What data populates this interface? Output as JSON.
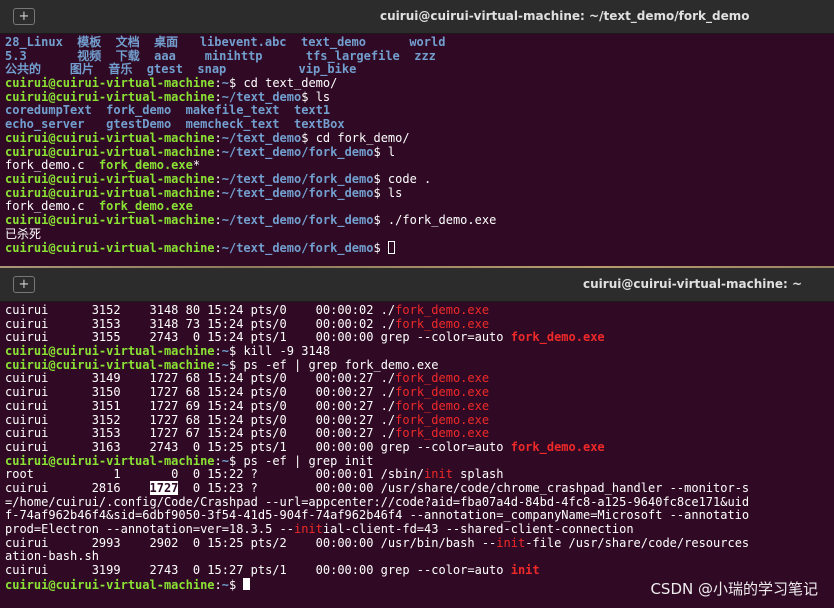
{
  "win1": {
    "title": "cuirui@cuirui-virtual-machine: ~/text_demo/fork_demo",
    "newtab_icon": "+"
  },
  "win2": {
    "title": "cuirui@cuirui-virtual-machine: ~",
    "newtab_icon": "+"
  },
  "t1": {
    "ls1": [
      "28_Linux  模板  文档  桌面   libevent.abc  text_demo      world",
      "5.3       视频  下载  aaa    minihttp      tfs_largefile  zzz",
      "公共的    图片  音乐  gtest  snap          vip_bike"
    ],
    "prompt_user": "cuirui@cuirui-virtual-machine",
    "path_home": "~",
    "path_text": "~/text_demo",
    "path_fork": "~/text_demo/fork_demo",
    "cmd_cd1": "cd text_demo/",
    "cmd_ls": "ls",
    "ls2": [
      "coredumpText  fork_demo  makefile_text  text1",
      "echo_server   gtestDemo  memcheck_text  textBox"
    ],
    "cmd_cd2": "cd fork_demo/",
    "cmd_l": "l",
    "l_file1": "fork_demo.c  ",
    "l_file2": "fork_demo.exe",
    "l_star": "*",
    "cmd_code": "code .",
    "cmd_ls3": "ls",
    "ls3_file1": "fork_demo.c  ",
    "ls3_file2": "fork_demo.exe",
    "cmd_run": "./fork_demo.exe",
    "killed": "已杀死"
  },
  "t2": {
    "prompt_user": "cuirui@cuirui-virtual-machine",
    "path_home": "~",
    "exe": "fork_demo.exe",
    "grep_match": "fork_demo.exe",
    "rows_a": [
      "cuirui      3152    3148 80 15:24 pts/0    00:00:02 ./",
      "cuirui      3153    3148 73 15:24 pts/0    00:00:02 ./",
      "cuirui      3155    2743  0 15:24 pts/1    00:00:00 grep --color=auto "
    ],
    "cmd_kill": "kill -9 3148",
    "cmd_ps1": "ps -ef | grep fork_demo.exe",
    "rows_b": [
      "cuirui      3149    1727 68 15:24 pts/0    00:00:27 ./",
      "cuirui      3150    1727 68 15:24 pts/0    00:00:27 ./",
      "cuirui      3151    1727 69 15:24 pts/0    00:00:27 ./",
      "cuirui      3152    1727 68 15:24 pts/0    00:00:27 ./",
      "cuirui      3153    1727 67 15:24 pts/0    00:00:27 ./",
      "cuirui      3163    2743  0 15:25 pts/1    00:00:00 grep --color=auto "
    ],
    "cmd_ps2": "ps -ef | grep init",
    "init": "init",
    "root_a": "root           1       0  0 15:22 ?        00:00:01 /sbin/",
    "root_b": " splash",
    "c2816_a": "cuirui      2816    ",
    "c2816_hl": "1727",
    "c2816_b": "  0 15:23 ?        00:00:00 /usr/share/code/chrome_crashpad_handler --monitor-s",
    "wrap1": "=/home/cuirui/.config/Code/Crashpad --url=appcenter://code?aid=fba07a4d-84bd-4fc8-a125-9640fc8ce171&uid",
    "wrap2": "f-74af962b46f4&sid=6dbf9050-3f54-41d5-904f-74af962b46f4 --annotation=_companyName=Microsoft --annotatio",
    "wrap3_a": "prod=Electron --annotation=ver=18.3.5 --",
    "wrap3_init": "init",
    "wrap3_b": "ial-client-fd=43 --shared-client-connection",
    "c2993_a": "cuirui      2993    2902  0 15:25 pts/2    00:00:00 /usr/bin/bash --",
    "c2993_b": "-file /usr/share/code/resources",
    "wrap4": "ation-bash.sh",
    "c3199": "cuirui      3199    2743  0 15:27 pts/1    00:00:00 grep --color=auto "
  },
  "watermark": "CSDN @小瑞的学习笔记"
}
